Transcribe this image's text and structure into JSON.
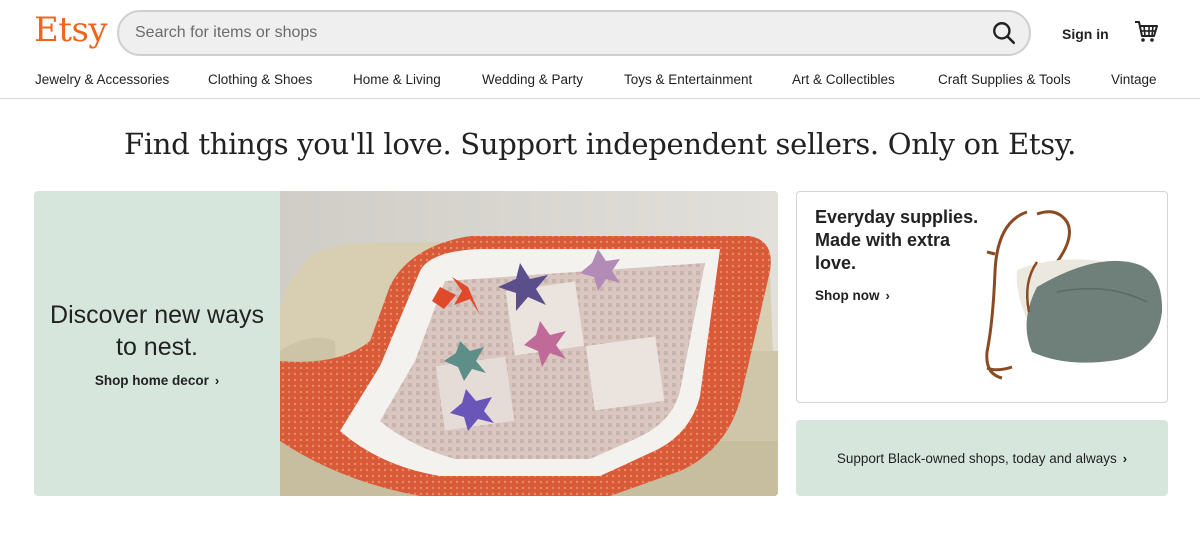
{
  "brand": {
    "logo": "Etsy",
    "accent": "#f1641e"
  },
  "search": {
    "placeholder": "Search for items or shops",
    "value": "",
    "icon": "search-icon"
  },
  "header": {
    "signin_label": "Sign in",
    "cart_icon": "cart-icon"
  },
  "nav": {
    "items": [
      {
        "label": "Jewelry & Accessories"
      },
      {
        "label": "Clothing & Shoes"
      },
      {
        "label": "Home & Living"
      },
      {
        "label": "Wedding & Party"
      },
      {
        "label": "Toys & Entertainment"
      },
      {
        "label": "Art & Collectibles"
      },
      {
        "label": "Craft Supplies & Tools"
      },
      {
        "label": "Vintage"
      }
    ]
  },
  "tagline": "Find things you'll love. Support independent sellers. Only on Etsy.",
  "hero": {
    "title_line1": "Discover new ways",
    "title_line2": "to nest.",
    "link_label": "Shop home decor",
    "bg_color": "#d7e6dd"
  },
  "promo": {
    "title_line1": "Everyday supplies.",
    "title_line2": "Made with extra",
    "title_line3": "love.",
    "link_label": "Shop now"
  },
  "banner": {
    "label": "Support Black-owned shops, today and always"
  },
  "icons": {
    "chevron": "›"
  }
}
